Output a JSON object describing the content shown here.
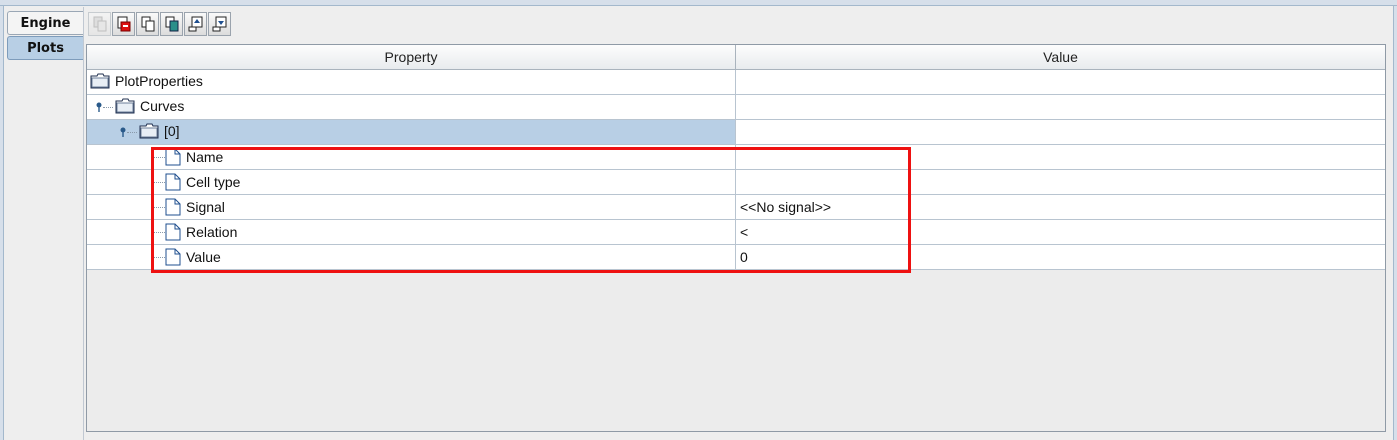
{
  "tabs": [
    {
      "label": "Engine",
      "selected": false
    },
    {
      "label": "Plots",
      "selected": true
    }
  ],
  "toolbar": {
    "buttons": [
      {
        "icon": "copy-disabled-icon",
        "enabled": false
      },
      {
        "icon": "delete-icon",
        "enabled": true
      },
      {
        "icon": "copy-icon",
        "enabled": true
      },
      {
        "icon": "paste-icon",
        "enabled": true
      },
      {
        "icon": "move-up-icon",
        "enabled": true
      },
      {
        "icon": "move-down-icon",
        "enabled": true
      }
    ]
  },
  "table": {
    "columns": {
      "property": "Property",
      "value": "Value"
    },
    "rows": [
      {
        "label": "PlotProperties",
        "value": "",
        "type": "folder",
        "level": 0
      },
      {
        "label": "Curves",
        "value": "",
        "type": "folder",
        "level": 1
      },
      {
        "label": "[0]",
        "value": "",
        "type": "folder",
        "level": 2,
        "selected": true
      },
      {
        "label": "Name",
        "value": "",
        "type": "leaf",
        "level": 3
      },
      {
        "label": "Cell type",
        "value": "",
        "type": "leaf",
        "level": 3
      },
      {
        "label": "Signal",
        "value": "<<No signal>>",
        "type": "leaf",
        "level": 3
      },
      {
        "label": "Relation",
        "value": "<",
        "type": "leaf",
        "level": 3
      },
      {
        "label": "Value",
        "value": "0",
        "type": "leaf",
        "level": 3
      }
    ]
  },
  "colors": {
    "highlight_box": "#ee1111",
    "selected_row": "#b8cfe5",
    "tree_icon": "#1f4f8f"
  }
}
